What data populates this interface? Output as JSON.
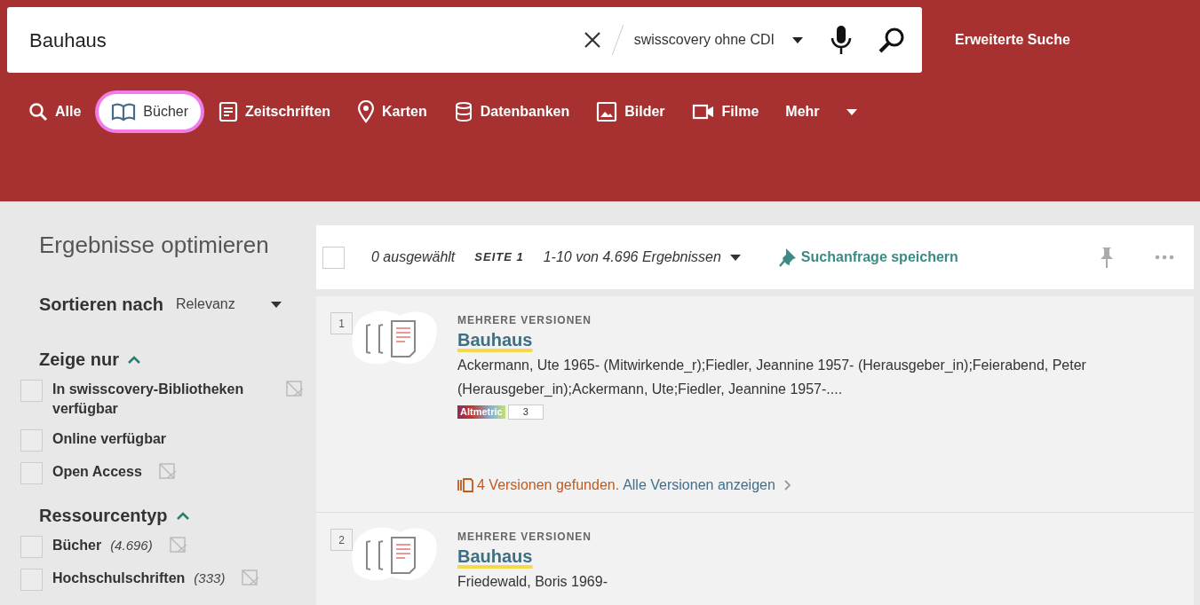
{
  "search": {
    "value": "Bauhaus",
    "scope": "swisscovery ohne CDI",
    "advanced": "Erweiterte Suche"
  },
  "tabs": [
    {
      "label": "Alle",
      "selected": false
    },
    {
      "label": "Bücher",
      "selected": true
    },
    {
      "label": "Zeitschriften",
      "selected": false
    },
    {
      "label": "Karten",
      "selected": false
    },
    {
      "label": "Datenbanken",
      "selected": false
    },
    {
      "label": "Bilder",
      "selected": false
    },
    {
      "label": "Filme",
      "selected": false
    },
    {
      "label": "Mehr",
      "selected": false
    }
  ],
  "sidebar": {
    "title": "Ergebnisse optimieren",
    "sort_label": "Sortieren nach",
    "sort_value": "Relevanz",
    "groups": [
      {
        "title": "Zeige nur",
        "expanded": true,
        "items": [
          {
            "label": "In swisscovery-Bibliotheken verfügbar",
            "checked": false,
            "excludable": true
          },
          {
            "label": "Online verfügbar",
            "checked": false,
            "excludable": false
          },
          {
            "label": "Open Access",
            "checked": false,
            "excludable": true
          }
        ]
      },
      {
        "title": "Ressourcentyp",
        "expanded": true,
        "items": [
          {
            "label": "Bücher",
            "count": "(4.696)",
            "checked": false,
            "excludable": true
          },
          {
            "label": "Hochschulschriften",
            "count": "(333)",
            "checked": false,
            "excludable": true
          }
        ]
      }
    ]
  },
  "toolbar": {
    "checked": false,
    "selected_count": "0 ausgewählt",
    "page": "SEITE 1",
    "range": "1-10 von 4.696 Ergebnissen",
    "save_query": "Suchanfrage speichern"
  },
  "results": [
    {
      "number": "1",
      "type": "MEHRERE VERSIONEN",
      "title": "Bauhaus",
      "authors": "Ackermann, Ute 1965- (Mitwirkende_r);Fiedler, Jeannine 1957- (Herausgeber_in);Feierabend, Peter (Herausgeber_in);Ackermann, Ute;Fiedler, Jeannine 1957-....",
      "altmetric": {
        "label": "Altmetric",
        "score": "3"
      },
      "versions": "4 Versionen gefunden.",
      "versions_link": "Alle Versionen anzeigen"
    },
    {
      "number": "2",
      "type": "MEHRERE VERSIONEN",
      "title": "Bauhaus",
      "authors": "Friedewald, Boris 1969-"
    }
  ]
}
